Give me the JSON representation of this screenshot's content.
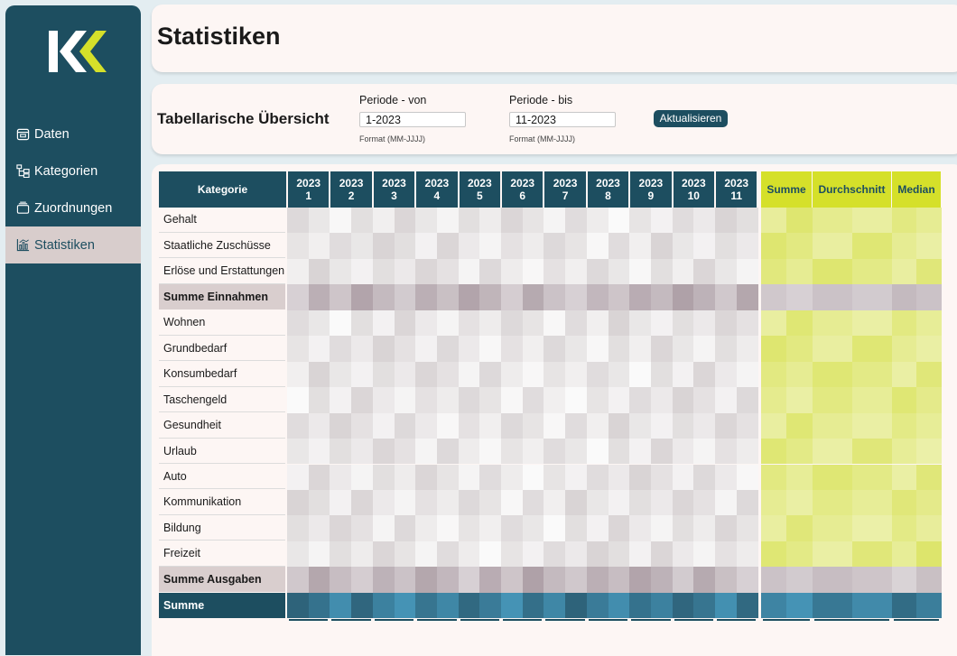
{
  "sidebar": {
    "items": [
      {
        "label": "Daten",
        "icon": "calendar-icon",
        "active": false
      },
      {
        "label": "Kategorien",
        "icon": "hierarchy-icon",
        "active": false
      },
      {
        "label": "Zuordnungen",
        "icon": "folders-icon",
        "active": false
      },
      {
        "label": "Statistiken",
        "icon": "chart-icon",
        "active": true
      }
    ]
  },
  "header": {
    "title": "Statistiken"
  },
  "filter": {
    "section_title": "Tabellarische Übersicht",
    "from_label": "Periode - von",
    "from_value": "1-2023",
    "from_hint": "Format (MM-JJJJ)",
    "to_label": "Periode - bis",
    "to_value": "11-2023",
    "to_hint": "Format (MM-JJJJ)",
    "update_label": "Aktualisieren"
  },
  "table": {
    "category_header": "Kategorie",
    "periods": [
      {
        "year": "2023",
        "month": "1"
      },
      {
        "year": "2023",
        "month": "2"
      },
      {
        "year": "2023",
        "month": "3"
      },
      {
        "year": "2023",
        "month": "4"
      },
      {
        "year": "2023",
        "month": "5"
      },
      {
        "year": "2023",
        "month": "6"
      },
      {
        "year": "2023",
        "month": "7"
      },
      {
        "year": "2023",
        "month": "8"
      },
      {
        "year": "2023",
        "month": "9"
      },
      {
        "year": "2023",
        "month": "10"
      },
      {
        "year": "2023",
        "month": "11"
      }
    ],
    "summary_headers": [
      "Summe",
      "Durchschnitt",
      "Median"
    ],
    "rows": [
      {
        "label": "Gehalt",
        "type": "item"
      },
      {
        "label": "Staatliche Zuschüsse",
        "type": "item"
      },
      {
        "label": "Erlöse und Erstattungen",
        "type": "item"
      },
      {
        "label": "Summe Einnahmen",
        "type": "sum"
      },
      {
        "label": "Wohnen",
        "type": "item"
      },
      {
        "label": "Grundbedarf",
        "type": "item"
      },
      {
        "label": "Konsumbedarf",
        "type": "item"
      },
      {
        "label": "Taschengeld",
        "type": "item"
      },
      {
        "label": "Gesundheit",
        "type": "item"
      },
      {
        "label": "Urlaub",
        "type": "item"
      },
      {
        "label": "Auto",
        "type": "item"
      },
      {
        "label": "Kommunikation",
        "type": "item"
      },
      {
        "label": "Bildung",
        "type": "item"
      },
      {
        "label": "Freizeit",
        "type": "item"
      },
      {
        "label": "Summe Ausgaben",
        "type": "sum"
      },
      {
        "label": "Summe",
        "type": "total"
      }
    ]
  },
  "colors": {
    "sidebar": "#1d4e60",
    "active_nav": "#d8cdcc",
    "accent_lime": "#d5e02a",
    "logo_white": "#ffffff",
    "logo_lime": "#d5e02a"
  }
}
